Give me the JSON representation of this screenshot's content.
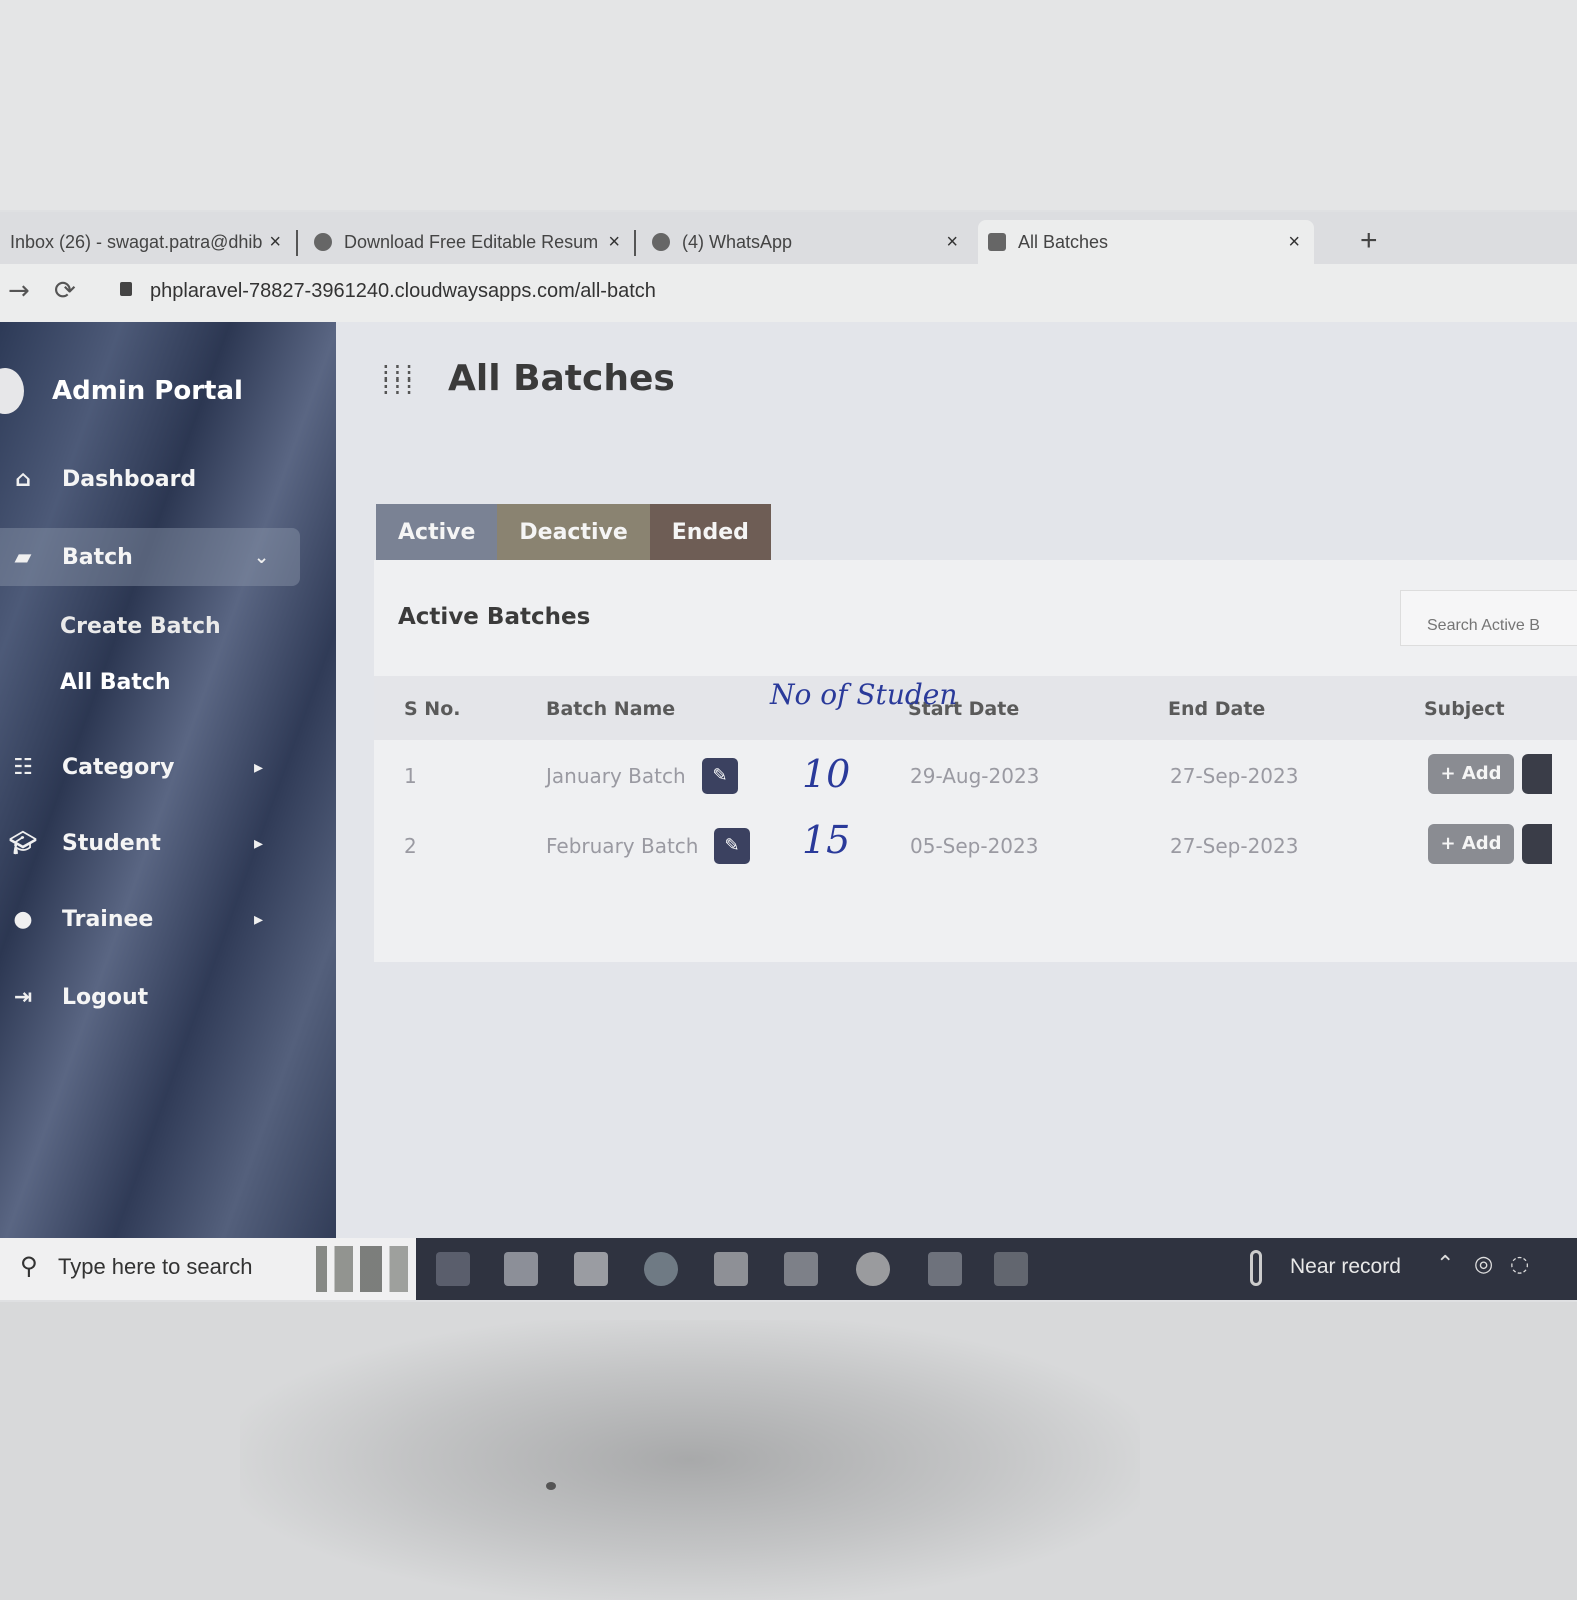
{
  "browser": {
    "tabs": [
      {
        "title": "Inbox (26) - swagat.patra@dhib"
      },
      {
        "title": "Download Free Editable Resum"
      },
      {
        "title": "(4) WhatsApp"
      },
      {
        "title": "All Batches"
      }
    ],
    "new_tab_label": "+",
    "url": "phplaravel-78827-3961240.cloudwaysapps.com/all-batch"
  },
  "sidebar": {
    "brand": "Admin Portal",
    "items": [
      {
        "label": "Dashboard",
        "icon": "home-icon"
      },
      {
        "label": "Batch",
        "icon": "folder-icon"
      },
      {
        "label": "Category",
        "icon": "category-icon"
      },
      {
        "label": "Student",
        "icon": "graduation-cap-icon"
      },
      {
        "label": "Trainee",
        "icon": "user-icon"
      },
      {
        "label": "Logout",
        "icon": "logout-icon"
      }
    ],
    "batch_submenu": [
      "Create Batch",
      "All Batch"
    ]
  },
  "main": {
    "page_title": "All Batches",
    "status_tabs": [
      "Active",
      "Deactive",
      "Ended"
    ],
    "card_title": "Active Batches",
    "search_placeholder": "Search Active B",
    "table": {
      "columns": [
        "S No.",
        "Batch Name",
        "Start Date",
        "End Date",
        "Subject"
      ],
      "rows": [
        {
          "sno": "1",
          "name": "January Batch",
          "start": "29-Aug-2023",
          "end": "27-Sep-2023",
          "subject_action": "+ Add"
        },
        {
          "sno": "2",
          "name": "February Batch",
          "start": "05-Sep-2023",
          "end": "27-Sep-2023",
          "subject_action": "+ Add"
        }
      ]
    },
    "handwritten_note": {
      "header": "No of Studen",
      "values": [
        "10",
        "15"
      ]
    }
  },
  "taskbar": {
    "search_placeholder": "Type here to search",
    "weather": "Near record"
  },
  "colors": {
    "sidebar": "#2d3a57",
    "tab_active": "#7a8294",
    "tab_deactive": "#8a8371",
    "tab_ended": "#6e5d55",
    "edit_button": "#3b4160",
    "add_button": "#8a8c92",
    "handwriting": "#2a3a9a"
  }
}
